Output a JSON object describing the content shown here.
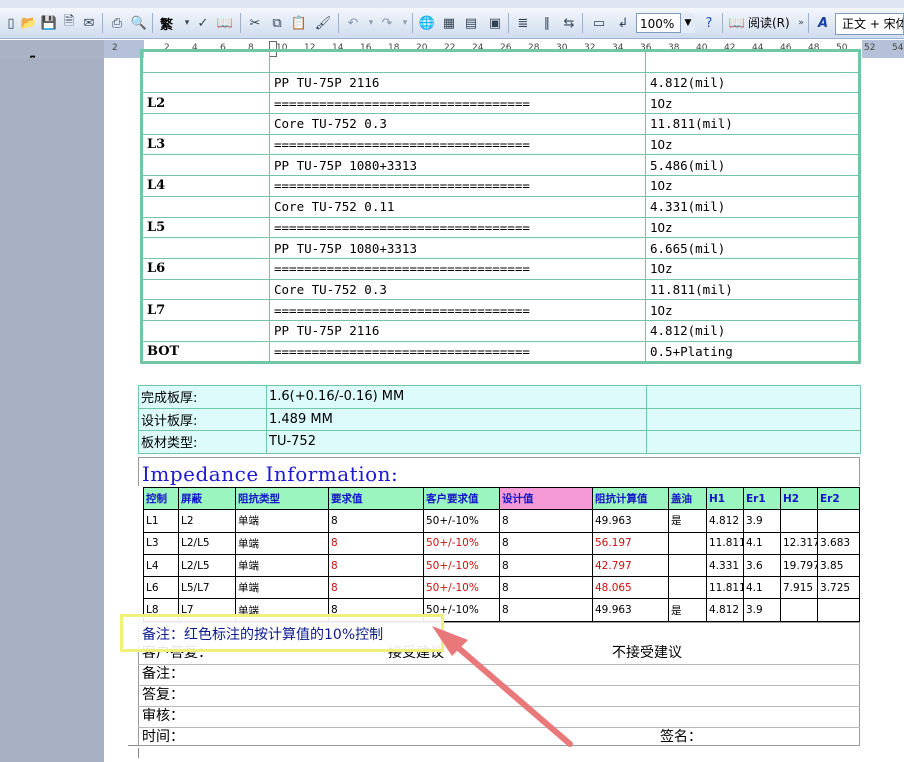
{
  "toolbar": {
    "font_convert_label": "繁",
    "zoom": "100%",
    "reading_label": "阅读(R)",
    "style_value": "正文 + 宋体"
  },
  "ruler": {
    "ticks": [
      "2",
      "2",
      "4",
      "6",
      "8",
      "10",
      "12",
      "14",
      "16",
      "18",
      "20",
      "22",
      "24",
      "26",
      "28",
      "30",
      "32",
      "34",
      "36",
      "38",
      "40",
      "42",
      "44",
      "46",
      "48",
      "50",
      "52",
      "54"
    ]
  },
  "stackup": {
    "rows": [
      {
        "label": "",
        "material": "PP      TU-75P     2116",
        "value": "4.812(mil)"
      },
      {
        "label": "L2",
        "material": "==================================",
        "value": "1Oz"
      },
      {
        "label": "",
        "material": "Core      TU-752     0.3",
        "value": "11.811(mil)"
      },
      {
        "label": "L3",
        "material": "==================================",
        "value": "1Oz"
      },
      {
        "label": "",
        "material": "PP      TU-75P     1080+3313",
        "value": "5.486(mil)"
      },
      {
        "label": "L4",
        "material": "==================================",
        "value": "1Oz"
      },
      {
        "label": "",
        "material": "Core      TU-752     0.11",
        "value": "4.331(mil)"
      },
      {
        "label": "L5",
        "material": "==================================",
        "value": "1Oz"
      },
      {
        "label": "",
        "material": "PP      TU-75P     1080+3313",
        "value": "6.665(mil)"
      },
      {
        "label": "L6",
        "material": "==================================",
        "value": "1Oz"
      },
      {
        "label": "",
        "material": "Core      TU-752     0.3",
        "value": "11.811(mil)"
      },
      {
        "label": "L7",
        "material": "==================================",
        "value": "1Oz"
      },
      {
        "label": "",
        "material": "PP      TU-75P     2116",
        "value": "4.812(mil)"
      },
      {
        "label": "BOT",
        "material": "==================================",
        "value": "0.5+Plating"
      }
    ]
  },
  "finish": {
    "rows": [
      {
        "label": "完成板厚:",
        "value": "1.6(+0.16/-0.16) MM",
        "extra": ""
      },
      {
        "label": "设计板厚:",
        "value": "1.489 MM",
        "extra": ""
      },
      {
        "label": "板材类型:",
        "value": "TU-752",
        "extra": ""
      }
    ]
  },
  "impedance": {
    "title": "Impedance Information:",
    "headers": [
      "控制",
      "屏蔽",
      "阻抗类型",
      "要求值",
      "客户要求值",
      "设计值",
      "阻抗计算值",
      "盖油",
      "H1",
      "Er1",
      "H2",
      "Er2"
    ],
    "rows": [
      {
        "cells": [
          "L1",
          "L2",
          "单端",
          "8",
          "50+/-10%",
          "8",
          "49.963",
          "是",
          "4.812",
          "3.9",
          "",
          ""
        ],
        "red": false
      },
      {
        "cells": [
          "L3",
          "L2/L5",
          "单端",
          "8",
          "50+/-10%",
          "8",
          "56.197",
          "",
          "11.811",
          "4.1",
          "12.317",
          "3.683"
        ],
        "red": true
      },
      {
        "cells": [
          "L4",
          "L2/L5",
          "单端",
          "8",
          "50+/-10%",
          "8",
          "42.797",
          "",
          "4.331",
          "3.6",
          "19.797",
          "3.85"
        ],
        "red": true
      },
      {
        "cells": [
          "L6",
          "L5/L7",
          "单端",
          "8",
          "50+/-10%",
          "8",
          "48.065",
          "",
          "11.811",
          "4.1",
          "7.915",
          "3.725"
        ],
        "red": true
      },
      {
        "cells": [
          "L8",
          "L7",
          "单端",
          "8",
          "50+/-10%",
          "8",
          "49.963",
          "是",
          "4.812",
          "3.9",
          "",
          ""
        ],
        "red": false
      }
    ]
  },
  "form": {
    "note_highlight": "备注：红色标注的按计算值的10%控制",
    "customer_reply_label": "客户答复：",
    "accept": "接受建议",
    "reject": "不接受建议",
    "remark_label": "备注：",
    "answer_label": "答复：",
    "review_label": "审核：",
    "time_label": "时间：",
    "sign_label": "签名："
  },
  "colors": {
    "stackup_border": "#6fc7a3",
    "finish_bg": "#ddfbfb",
    "header_green": "#9bf5bf",
    "header_pink": "#f59ad6",
    "header_text": "#1414c8",
    "red_text": "#cc1010",
    "title_blue": "#1e1ad0",
    "highlight_yellow": "#f0f07a",
    "arrow": "#e8787a"
  }
}
